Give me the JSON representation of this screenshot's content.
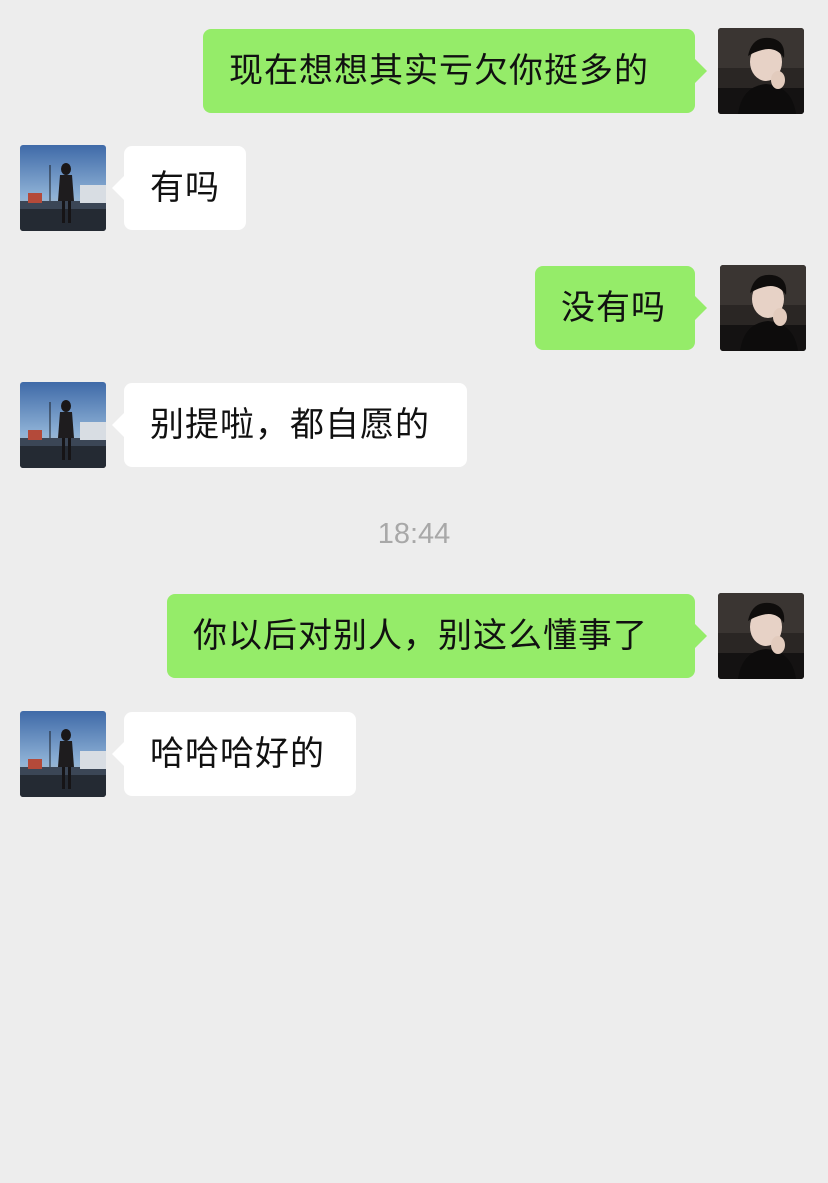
{
  "chat": {
    "messages": [
      {
        "side": "sent",
        "text": "现在想想其实亏欠你挺多的",
        "avatar": "self-avatar"
      },
      {
        "side": "received",
        "text": "有吗",
        "avatar": "contact-avatar"
      },
      {
        "side": "sent",
        "text": "没有吗",
        "avatar": "self-avatar"
      },
      {
        "side": "received",
        "text": "别提啦，都自愿的",
        "avatar": "contact-avatar"
      },
      {
        "side": "sent",
        "text": "你以后对别人，别这么懂事了",
        "avatar": "self-avatar"
      },
      {
        "side": "received",
        "text": "哈哈哈好的",
        "avatar": "contact-avatar"
      }
    ],
    "timestamp": "18:44"
  },
  "colors": {
    "background": "#ededed",
    "sent_bubble": "#95ec69",
    "received_bubble": "#ffffff",
    "timestamp_text": "#a8a8a8"
  }
}
